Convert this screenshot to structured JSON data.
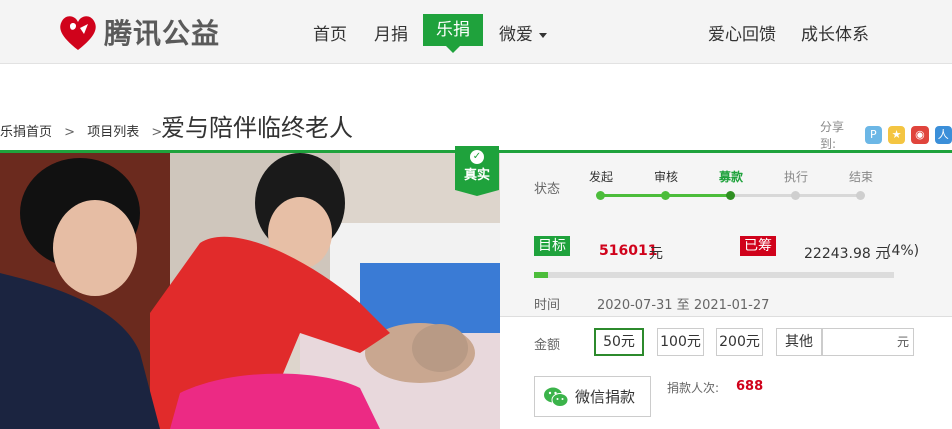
{
  "brand": {
    "name": "腾讯公益"
  },
  "nav": {
    "items": [
      "首页",
      "月捐",
      "乐捐",
      "微爱"
    ],
    "active": "乐捐",
    "right": [
      "爱心回馈",
      "成长体系"
    ]
  },
  "breadcrumb": {
    "home": "乐捐首页",
    "sep": ">",
    "list": "项目列表",
    "sep2": ">"
  },
  "project": {
    "title": "爱与陪伴临终老人"
  },
  "share": {
    "label": "分享到:"
  },
  "badge": {
    "label": "真实"
  },
  "status": {
    "label": "状态",
    "steps": [
      "发起",
      "审核",
      "募款",
      "执行",
      "结束"
    ],
    "current_step": "募款"
  },
  "goal": {
    "label": "目标",
    "amount": "516011",
    "unit": "元"
  },
  "raised": {
    "label": "已筹",
    "amount": "22243.98 元",
    "percent": "(4%)",
    "fraction": 0.04
  },
  "time": {
    "label": "时间",
    "range": "2020-07-31 至 2021-01-27"
  },
  "amount": {
    "label": "金额",
    "options": [
      "50元",
      "100元",
      "200元",
      "其他"
    ],
    "selected": "50元",
    "custom_unit": "元"
  },
  "donate": {
    "button_label": "微信捐款"
  },
  "donors": {
    "label": "捐款人次:",
    "count": "688"
  },
  "colors": {
    "accent": "#1fa23c",
    "tag_red": "#d0021b"
  }
}
